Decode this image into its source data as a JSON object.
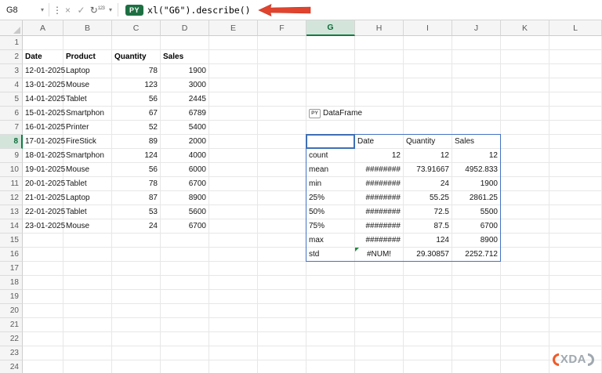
{
  "formula_bar": {
    "name_box": "G8",
    "py_badge": "PY",
    "formula": "xl(\"G6\").describe()"
  },
  "icons": {
    "chevron_down": "▾",
    "kebab": "⋮",
    "cancel": "×",
    "enter": "✓",
    "refresh": "↻",
    "numbers": "123"
  },
  "grid": {
    "columns": [
      "A",
      "B",
      "C",
      "D",
      "E",
      "F",
      "G",
      "H",
      "I",
      "J",
      "K",
      "L"
    ],
    "row_count": 24,
    "active_cell": "G8",
    "active_column": "G",
    "active_row": 8
  },
  "source_table": {
    "header_row": 2,
    "data_start_row": 3,
    "headers": [
      "Date",
      "Product",
      "Quantity",
      "Sales"
    ],
    "rows": [
      [
        "12-01-2025",
        "Laptop",
        "78",
        "1900"
      ],
      [
        "13-01-2025",
        "Mouse",
        "123",
        "3000"
      ],
      [
        "14-01-2025",
        "Tablet",
        "56",
        "2445"
      ],
      [
        "15-01-2025",
        "Smartphon",
        "67",
        "6789"
      ],
      [
        "16-01-2025",
        "Printer",
        "52",
        "5400"
      ],
      [
        "17-01-2025",
        "FireStick",
        "89",
        "2000"
      ],
      [
        "18-01-2025",
        "Smartphon",
        "124",
        "4000"
      ],
      [
        "19-01-2025",
        "Mouse",
        "56",
        "6000"
      ],
      [
        "20-01-2025",
        "Tablet",
        "78",
        "6700"
      ],
      [
        "21-01-2025",
        "Laptop",
        "87",
        "8900"
      ],
      [
        "22-01-2025",
        "Tablet",
        "53",
        "5600"
      ],
      [
        "23-01-2025",
        "Mouse",
        "24",
        "6700"
      ]
    ]
  },
  "python_cell": {
    "cell": "G6",
    "icon_label": "PY",
    "type_label": "DataFrame"
  },
  "describe_output": {
    "origin_cell": "G8",
    "origin_row": 8,
    "column_headers": [
      "Date",
      "Quantity",
      "Sales"
    ],
    "stat_rows": [
      [
        "count",
        "12",
        "12",
        "12"
      ],
      [
        "mean",
        "########",
        "73.91667",
        "4952.833"
      ],
      [
        "min",
        "########",
        "24",
        "1900"
      ],
      [
        "25%",
        "########",
        "55.25",
        "2861.25"
      ],
      [
        "50%",
        "########",
        "72.5",
        "5500"
      ],
      [
        "75%",
        "########",
        "87.5",
        "6700"
      ],
      [
        "max",
        "########",
        "124",
        "8900"
      ],
      [
        "std",
        "#NUM!",
        "29.30857",
        "2252.712"
      ]
    ]
  },
  "watermark": {
    "text": "XDA"
  },
  "colors": {
    "accent_green": "#107c41",
    "py_badge_green": "#1d6f42",
    "spill_border_blue": "#4472c4",
    "arrow_red": "#e0442e",
    "error_indicator_green": "#1e8a3c"
  }
}
